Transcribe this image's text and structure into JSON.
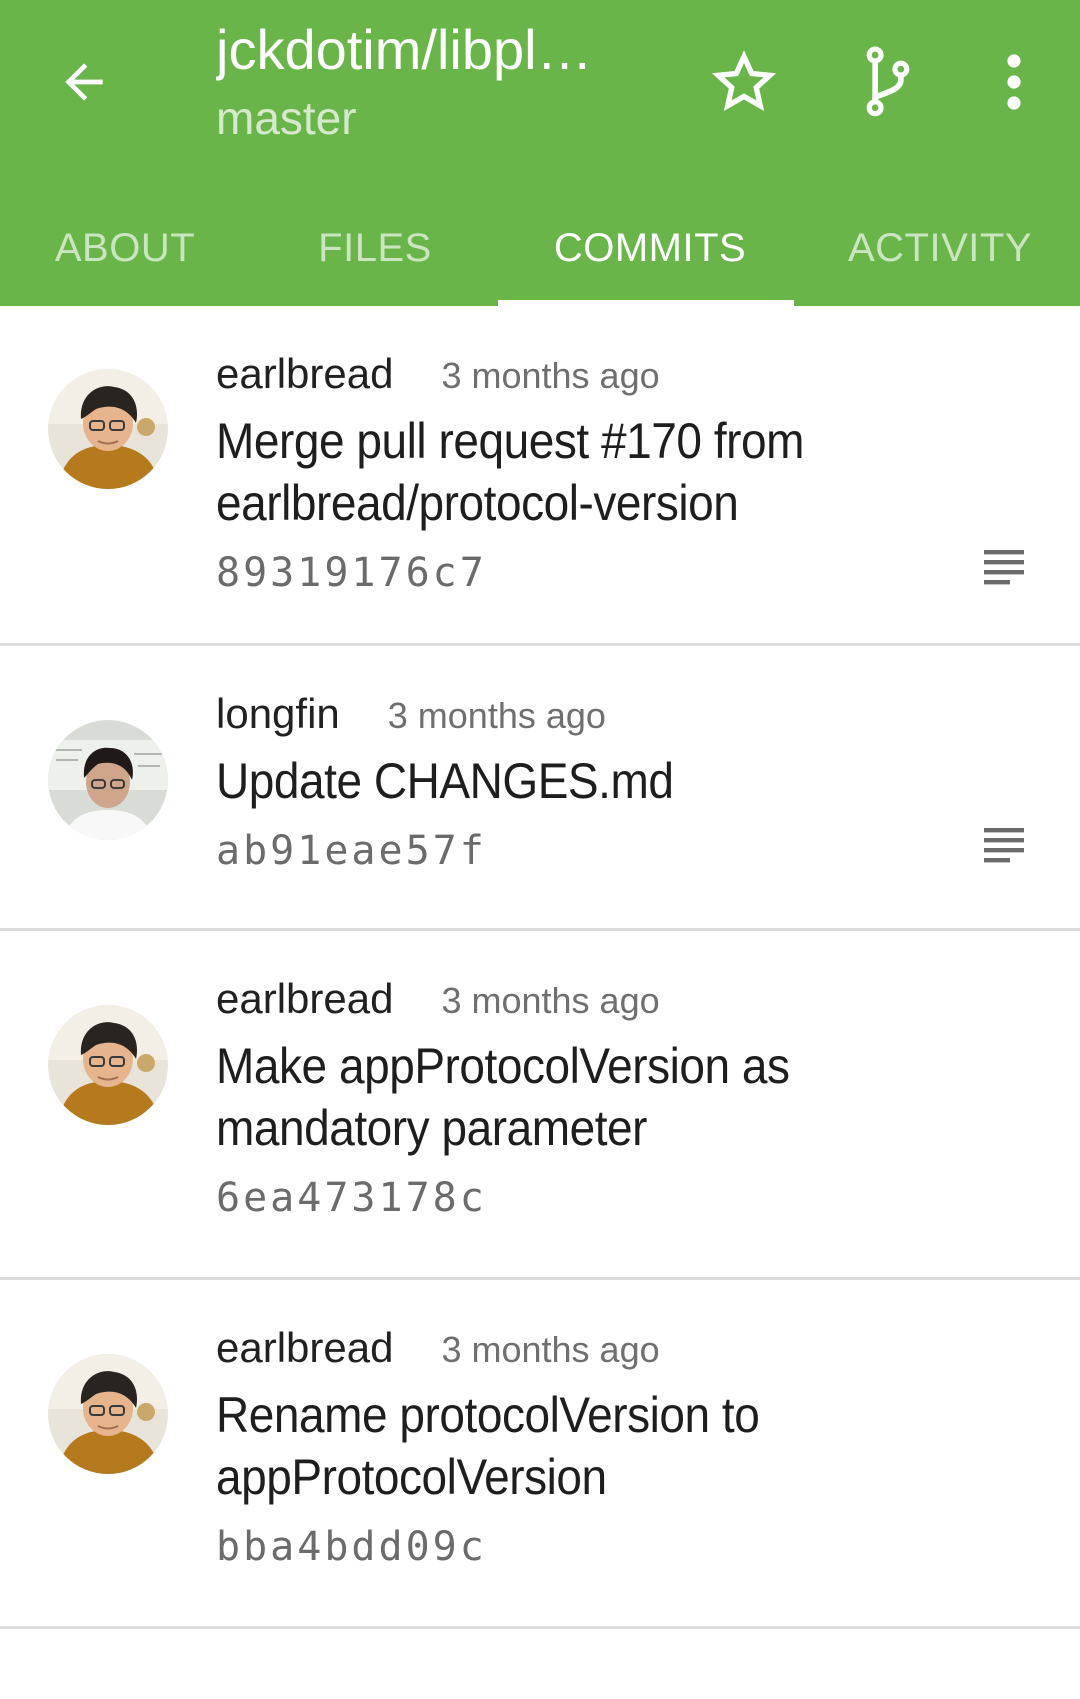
{
  "appbar": {
    "repo_title": "jckdotim/libpl…",
    "branch": "master",
    "back_icon": "arrow-left-icon",
    "star_icon": "star-outline-icon",
    "branch_icon": "branch-icon",
    "more_icon": "more-vertical-icon",
    "color": "#6ab54a"
  },
  "tabs": [
    {
      "label": "ABOUT",
      "selected": false
    },
    {
      "label": "FILES",
      "selected": false
    },
    {
      "label": "COMMITS",
      "selected": true
    },
    {
      "label": "ACTIVITY",
      "selected": false
    }
  ],
  "commits": [
    {
      "author": "earlbread",
      "time": "3 months ago",
      "message": "Merge pull request #170 from earlbread/protocol-version",
      "sha": "89319176c7",
      "has_description": true
    },
    {
      "author": "longfin",
      "time": "3 months ago",
      "message": "Update CHANGES.md",
      "sha": "ab91eae57f",
      "has_description": true
    },
    {
      "author": "earlbread",
      "time": "3 months ago",
      "message": "Make appProtocolVersion as mandatory parameter",
      "sha": "6ea473178c",
      "has_description": false
    },
    {
      "author": "earlbread",
      "time": "3 months ago",
      "message": "Rename protocolVersion to appProtocolVersion",
      "sha": "bba4bdd09c",
      "has_description": false
    }
  ]
}
